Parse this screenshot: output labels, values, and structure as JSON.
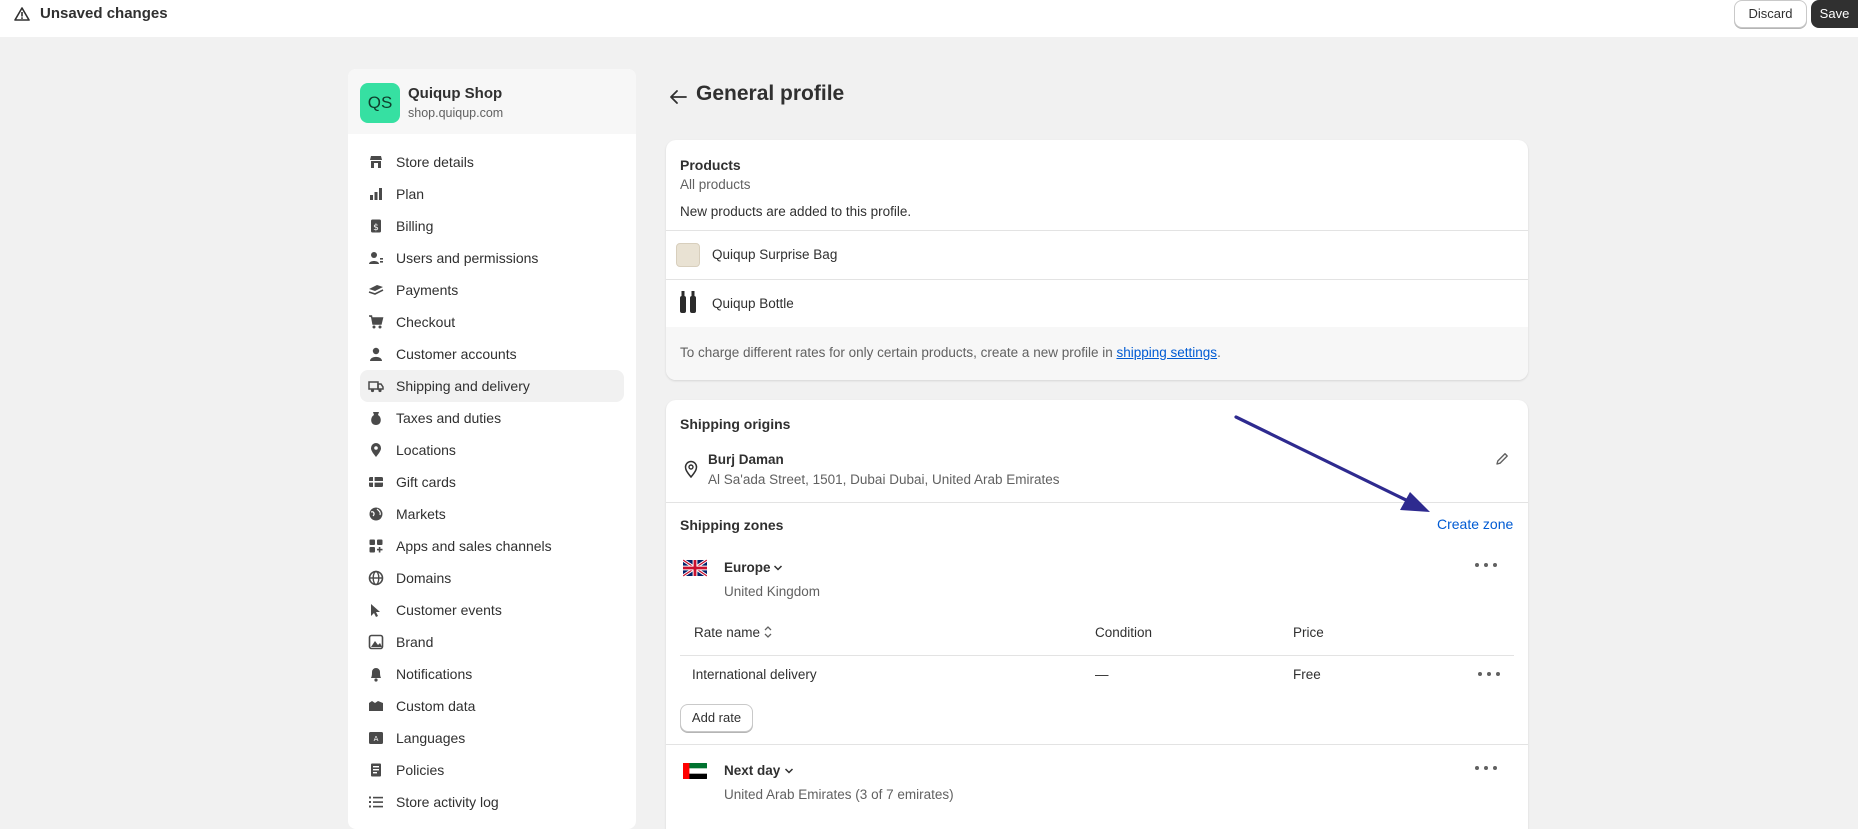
{
  "topbar": {
    "title": "Unsaved changes",
    "discard_label": "Discard",
    "save_label": "Save"
  },
  "shop": {
    "initials": "QS",
    "name": "Quiqup Shop",
    "url": "shop.quiqup.com"
  },
  "sidebar": {
    "items": [
      {
        "label": "Store details",
        "icon": "store-icon"
      },
      {
        "label": "Plan",
        "icon": "plan-icon"
      },
      {
        "label": "Billing",
        "icon": "billing-icon"
      },
      {
        "label": "Users and permissions",
        "icon": "users-icon"
      },
      {
        "label": "Payments",
        "icon": "payments-icon"
      },
      {
        "label": "Checkout",
        "icon": "cart-icon"
      },
      {
        "label": "Customer accounts",
        "icon": "person-icon"
      },
      {
        "label": "Shipping and delivery",
        "icon": "truck-icon",
        "active": true
      },
      {
        "label": "Taxes and duties",
        "icon": "taxes-icon"
      },
      {
        "label": "Locations",
        "icon": "location-icon"
      },
      {
        "label": "Gift cards",
        "icon": "gift-card-icon"
      },
      {
        "label": "Markets",
        "icon": "globe-icon"
      },
      {
        "label": "Apps and sales channels",
        "icon": "apps-icon"
      },
      {
        "label": "Domains",
        "icon": "domains-icon"
      },
      {
        "label": "Customer events",
        "icon": "events-icon"
      },
      {
        "label": "Brand",
        "icon": "brand-icon"
      },
      {
        "label": "Notifications",
        "icon": "bell-icon"
      },
      {
        "label": "Custom data",
        "icon": "custom-data-icon"
      },
      {
        "label": "Languages",
        "icon": "languages-icon"
      },
      {
        "label": "Policies",
        "icon": "policies-icon"
      },
      {
        "label": "Store activity log",
        "icon": "list-icon"
      }
    ]
  },
  "page": {
    "title": "General profile"
  },
  "products": {
    "heading": "Products",
    "subheading": "All products",
    "description": "New products are added to this profile.",
    "items": [
      {
        "name": "Quiqup Surprise Bag"
      },
      {
        "name": "Quiqup Bottle"
      }
    ],
    "note_prefix": "To charge different rates for only certain products, create a new profile in ",
    "note_link": "shipping settings",
    "note_suffix": "."
  },
  "origins": {
    "heading": "Shipping origins",
    "name": "Burj Daman",
    "address": "Al Sa'ada Street, 1501, Dubai Dubai, United Arab Emirates"
  },
  "zones": {
    "heading": "Shipping zones",
    "create_label": "Create zone",
    "list": [
      {
        "name": "Europe",
        "countries": "United Kingdom",
        "columns": {
          "rate": "Rate name",
          "condition": "Condition",
          "price": "Price"
        },
        "rates": [
          {
            "name": "International delivery",
            "condition": "—",
            "price": "Free"
          }
        ],
        "add_rate_label": "Add rate"
      },
      {
        "name": "Next day",
        "countries": "United Arab Emirates (3 of 7 emirates)"
      }
    ]
  },
  "colors": {
    "accent_link": "#005bd3",
    "avatar": "#36e0a2",
    "annotation_arrow": "#2e2a8f"
  }
}
